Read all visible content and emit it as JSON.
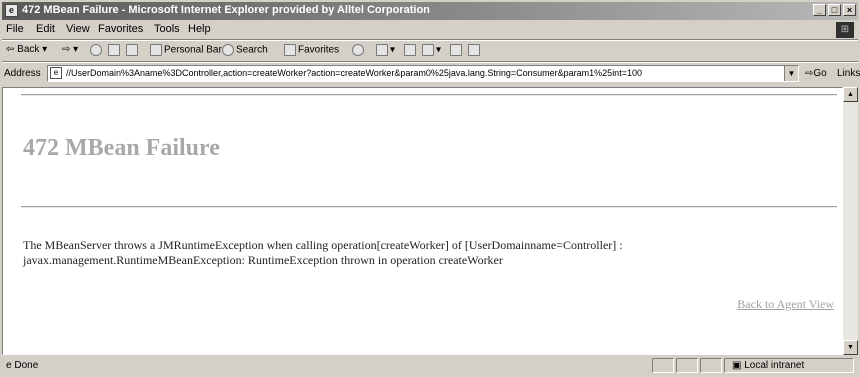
{
  "window": {
    "title": "472 MBean Failure - Microsoft Internet Explorer provided by Alltel Corporation",
    "controls": [
      "_",
      "□",
      "×"
    ]
  },
  "menu": [
    "File",
    "Edit",
    "View",
    "Favorites",
    "Tools",
    "Help"
  ],
  "toolbar": {
    "back": "Back",
    "personal_bar": "Personal Bar",
    "search": "Search",
    "favorites": "Favorites"
  },
  "address": {
    "label": "Address",
    "url": "//UserDomain%3Aname%3DController,action=createWorker?action=createWorker&param0%25java.lang.String=Consumer&param1%25int=100",
    "go": "Go",
    "links": "Links"
  },
  "page": {
    "heading": "472 MBean Failure",
    "message_line1": "The MBeanServer throws a JMRuntimeException when calling operation[createWorker] of [UserDomainname=Controller] :",
    "message_line2": "javax.management.RuntimeMBeanException: RuntimeException thrown in operation createWorker",
    "back_link": "Back to Agent View"
  },
  "status": {
    "text": "Done",
    "zone": "Local intranet"
  },
  "icons": [
    "ie-page-icon",
    "back-arrow-icon",
    "forward-arrow-icon",
    "stop-icon",
    "refresh-icon",
    "home-icon",
    "search-icon",
    "favorites-icon",
    "history-icon",
    "mail-icon",
    "print-icon",
    "edit-icon"
  ]
}
